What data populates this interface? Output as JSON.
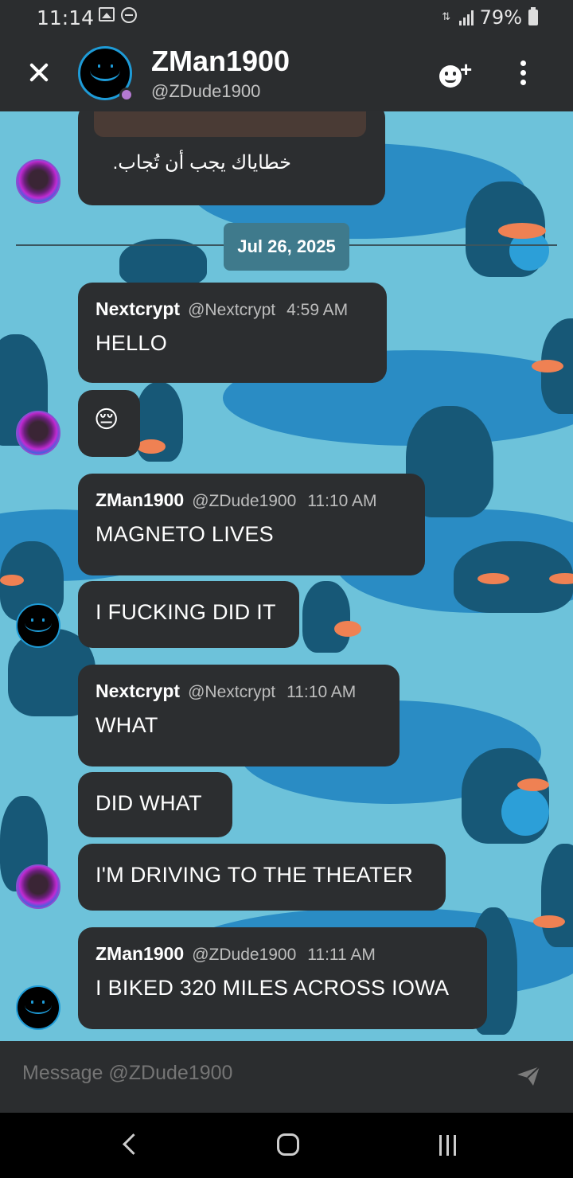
{
  "status_bar": {
    "time": "11:14",
    "battery": "79%"
  },
  "header": {
    "name": "ZMan1900",
    "handle": "@ZDude1900"
  },
  "previous_message": {
    "text": "خطاياك يجب أن تُجاب."
  },
  "date_divider": "Jul 26, 2025",
  "messages": [
    {
      "author": "Nextcrypt",
      "handle": "@Nextcrypt",
      "time": "4:59 AM",
      "lines": [
        "HELLO",
        "😔"
      ]
    },
    {
      "author": "ZMan1900",
      "handle": "@ZDude1900",
      "time": "11:10 AM",
      "lines": [
        "MAGNETO LIVES",
        "I FUCKING DID IT"
      ]
    },
    {
      "author": "Nextcrypt",
      "handle": "@Nextcrypt",
      "time": "11:10 AM",
      "lines": [
        "WHAT",
        "DID WHAT",
        "I'M DRIVING TO THE THEATER"
      ]
    },
    {
      "author": "ZMan1900",
      "handle": "@ZDude1900",
      "time": "11:11 AM",
      "lines": [
        "I BIKED 320 MILES ACROSS IOWA"
      ]
    }
  ],
  "composer": {
    "placeholder": "Message @ZDude1900"
  },
  "icons": [
    "close-icon",
    "add-friend-icon",
    "more-options-icon",
    "send-icon",
    "back-icon",
    "home-icon",
    "recent-apps-icon"
  ]
}
